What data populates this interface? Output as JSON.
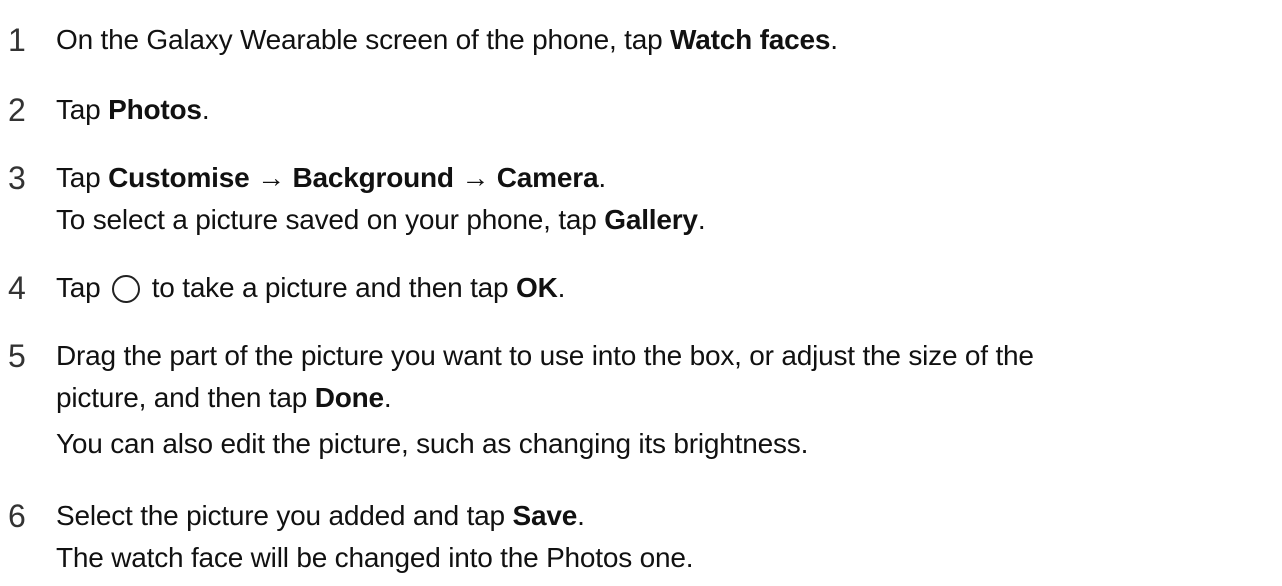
{
  "steps": [
    {
      "number": "1",
      "lines": [
        [
          "On the Galaxy Wearable screen of the phone, tap ",
          "Watch faces",
          "."
        ]
      ]
    },
    {
      "number": "2",
      "lines": [
        [
          "Tap ",
          "Photos",
          "."
        ]
      ]
    },
    {
      "number": "3",
      "lines": [
        [
          "Tap ",
          "Customise",
          " → ",
          "Background",
          " → ",
          "Camera",
          "."
        ],
        [
          "To select a picture saved on your phone, tap ",
          "Gallery",
          "."
        ]
      ]
    },
    {
      "number": "4",
      "lines": [
        [
          "Tap ",
          "{circle-icon}",
          " to take a picture and then tap ",
          "OK",
          "."
        ]
      ]
    },
    {
      "number": "5",
      "lines": [
        [
          "Drag the part of the picture you want to use into the box, or adjust the size of the"
        ],
        [
          "picture, and then tap ",
          "Done",
          "."
        ],
        [
          "You can also edit the picture, such as changing its brightness."
        ]
      ]
    },
    {
      "number": "6",
      "lines": [
        [
          "Select the picture you added and tap ",
          "Save",
          "."
        ],
        [
          "The watch face will be changed into the Photos one."
        ]
      ]
    }
  ]
}
